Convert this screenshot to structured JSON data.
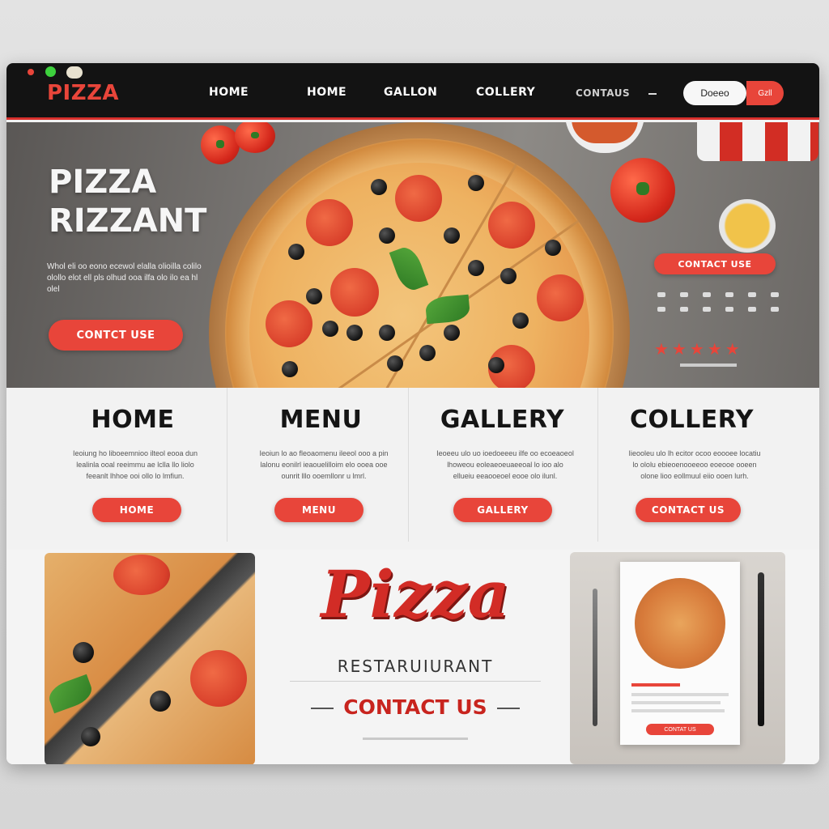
{
  "nav": {
    "logo": "PIZZA",
    "links": [
      "HOME",
      "HOME",
      "GALLON",
      "COLLERY",
      "CONTAUS"
    ],
    "search_label": "Doeeo",
    "action_label": "Gzll"
  },
  "hero": {
    "title_line1": "PIZZA",
    "title_line2": "RIZZANT",
    "text": "Whol eli oo eono ecewol elalla olioilla colilo olollo elot ell pls olhud ooa ilfa olo ilo ea hl olel",
    "cta": "CONTCT USE",
    "side_cta": "CONTACT USE",
    "rating": "★★★★★"
  },
  "sections": [
    {
      "title": "HOME",
      "text": "Ieoiung ho liboeemnioo ilteol eooa dun lealinla ooal reeimmu ae lclla llo liolo feeanlt lhhoe ooi ollo lo lmfiun.",
      "button": "HOME"
    },
    {
      "title": "MENU",
      "text": "Ieoiun lo ao fleoaomenu ileeol ooo a pin lalonu eonilrl ieaouelilloim elo ooea ooe ounrit lllo ooemllonr u lmrl.",
      "button": "MENU"
    },
    {
      "title": "GALLERY",
      "text": "Ieoeeu ulo uo ioedoeeeu ilfe oo ecoeaoeol lhoweou eoleaeoeuaeeoal lo ioo alo ellueiu eeaooeoel eooe olo ilunl.",
      "button": "GALLERY"
    },
    {
      "title": "COLLERY",
      "text": "Iieooleu ulo lh ecitor ocoo eoooee locatiu lo ololu ebieoenooeeoo eoeooe ooeen olone lioo eollmuul eiio ooen lurh.",
      "button": "CONTACT US"
    }
  ],
  "brand": {
    "name": "Pizza",
    "subtitle": "RESTARUIURANT",
    "contact": "CONTACT US"
  },
  "menu_card": {
    "button": "CONTAT US"
  }
}
